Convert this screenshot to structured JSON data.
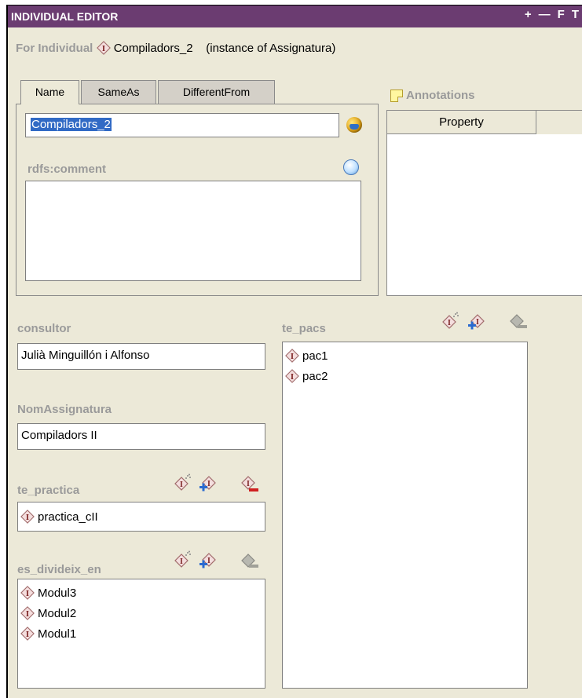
{
  "window": {
    "title": "INDIVIDUAL EDITOR",
    "buttons": [
      "+",
      "—",
      "F",
      "T"
    ]
  },
  "header": {
    "for_label": "For Individual",
    "individual": "Compiladors_2",
    "instance_of": "(instance of Assignatura)"
  },
  "tabs": [
    {
      "label": "Name",
      "active": true
    },
    {
      "label": "SameAs",
      "active": false
    },
    {
      "label": "DifferentFrom",
      "active": false
    }
  ],
  "name_field": {
    "value": "Compiladors_2"
  },
  "comment": {
    "label": "rdfs:comment",
    "value": ""
  },
  "annotations": {
    "label": "Annotations",
    "column": "Property"
  },
  "consultor": {
    "label": "consultor",
    "value": "Julià Minguillón i Alfonso"
  },
  "nom_assignatura": {
    "label": "NomAssignatura",
    "value": "Compiladors II"
  },
  "te_practica": {
    "label": "te_practica",
    "items": [
      "practica_cII"
    ]
  },
  "es_divideix_en": {
    "label": "es_divideix_en",
    "items": [
      "Modul3",
      "Modul2",
      "Modul1"
    ]
  },
  "te_pacs": {
    "label": "te_pacs",
    "items": [
      "pac1",
      "pac2"
    ]
  },
  "icons": {
    "individual": "individual-diamond-icon",
    "create": "create-instance-icon",
    "add": "add-instance-icon",
    "remove": "remove-instance-icon",
    "globe": "language-globe-icon",
    "comment_add": "add-comment-icon",
    "note": "annotation-note-icon"
  },
  "colors": {
    "title_bg": "#6b3c71",
    "panel_bg": "#ece9d8",
    "label_gray": "#9a9a9a",
    "selection": "#316ac5"
  }
}
